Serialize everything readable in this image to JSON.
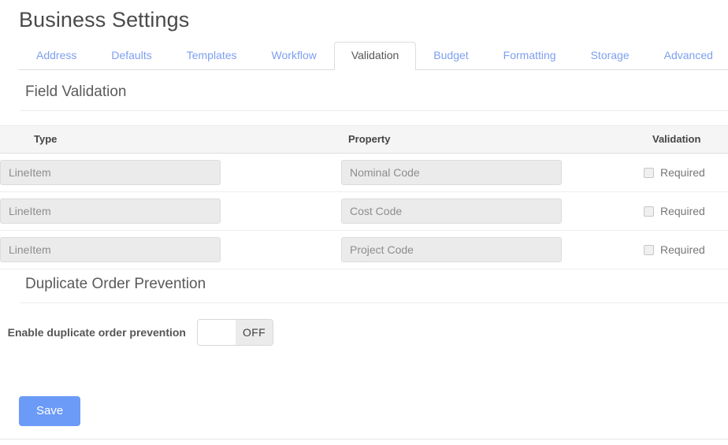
{
  "page": {
    "title": "Business Settings"
  },
  "tabs": [
    {
      "label": "Address",
      "active": false
    },
    {
      "label": "Defaults",
      "active": false
    },
    {
      "label": "Templates",
      "active": false
    },
    {
      "label": "Workflow",
      "active": false
    },
    {
      "label": "Validation",
      "active": true
    },
    {
      "label": "Budget",
      "active": false
    },
    {
      "label": "Formatting",
      "active": false
    },
    {
      "label": "Storage",
      "active": false
    },
    {
      "label": "Advanced",
      "active": false
    }
  ],
  "field_validation": {
    "section_title": "Field Validation",
    "columns": [
      "Type",
      "Property",
      "Validation"
    ],
    "rows": [
      {
        "type": "LineItem",
        "property": "Nominal Code",
        "validation_label": "Required",
        "checked": false
      },
      {
        "type": "LineItem",
        "property": "Cost Code",
        "validation_label": "Required",
        "checked": false
      },
      {
        "type": "LineItem",
        "property": "Project Code",
        "validation_label": "Required",
        "checked": false
      }
    ]
  },
  "duplicate_order_prevention": {
    "section_title": "Duplicate Order Prevention",
    "toggle_label": "Enable duplicate order prevention",
    "toggle_state": "OFF"
  },
  "actions": {
    "save_label": "Save"
  },
  "colors": {
    "accent_blue": "#6b9bf7",
    "tab_link": "#7d9ff0",
    "header_row_bg": "#f5f5f5",
    "input_bg": "#ebebeb"
  }
}
